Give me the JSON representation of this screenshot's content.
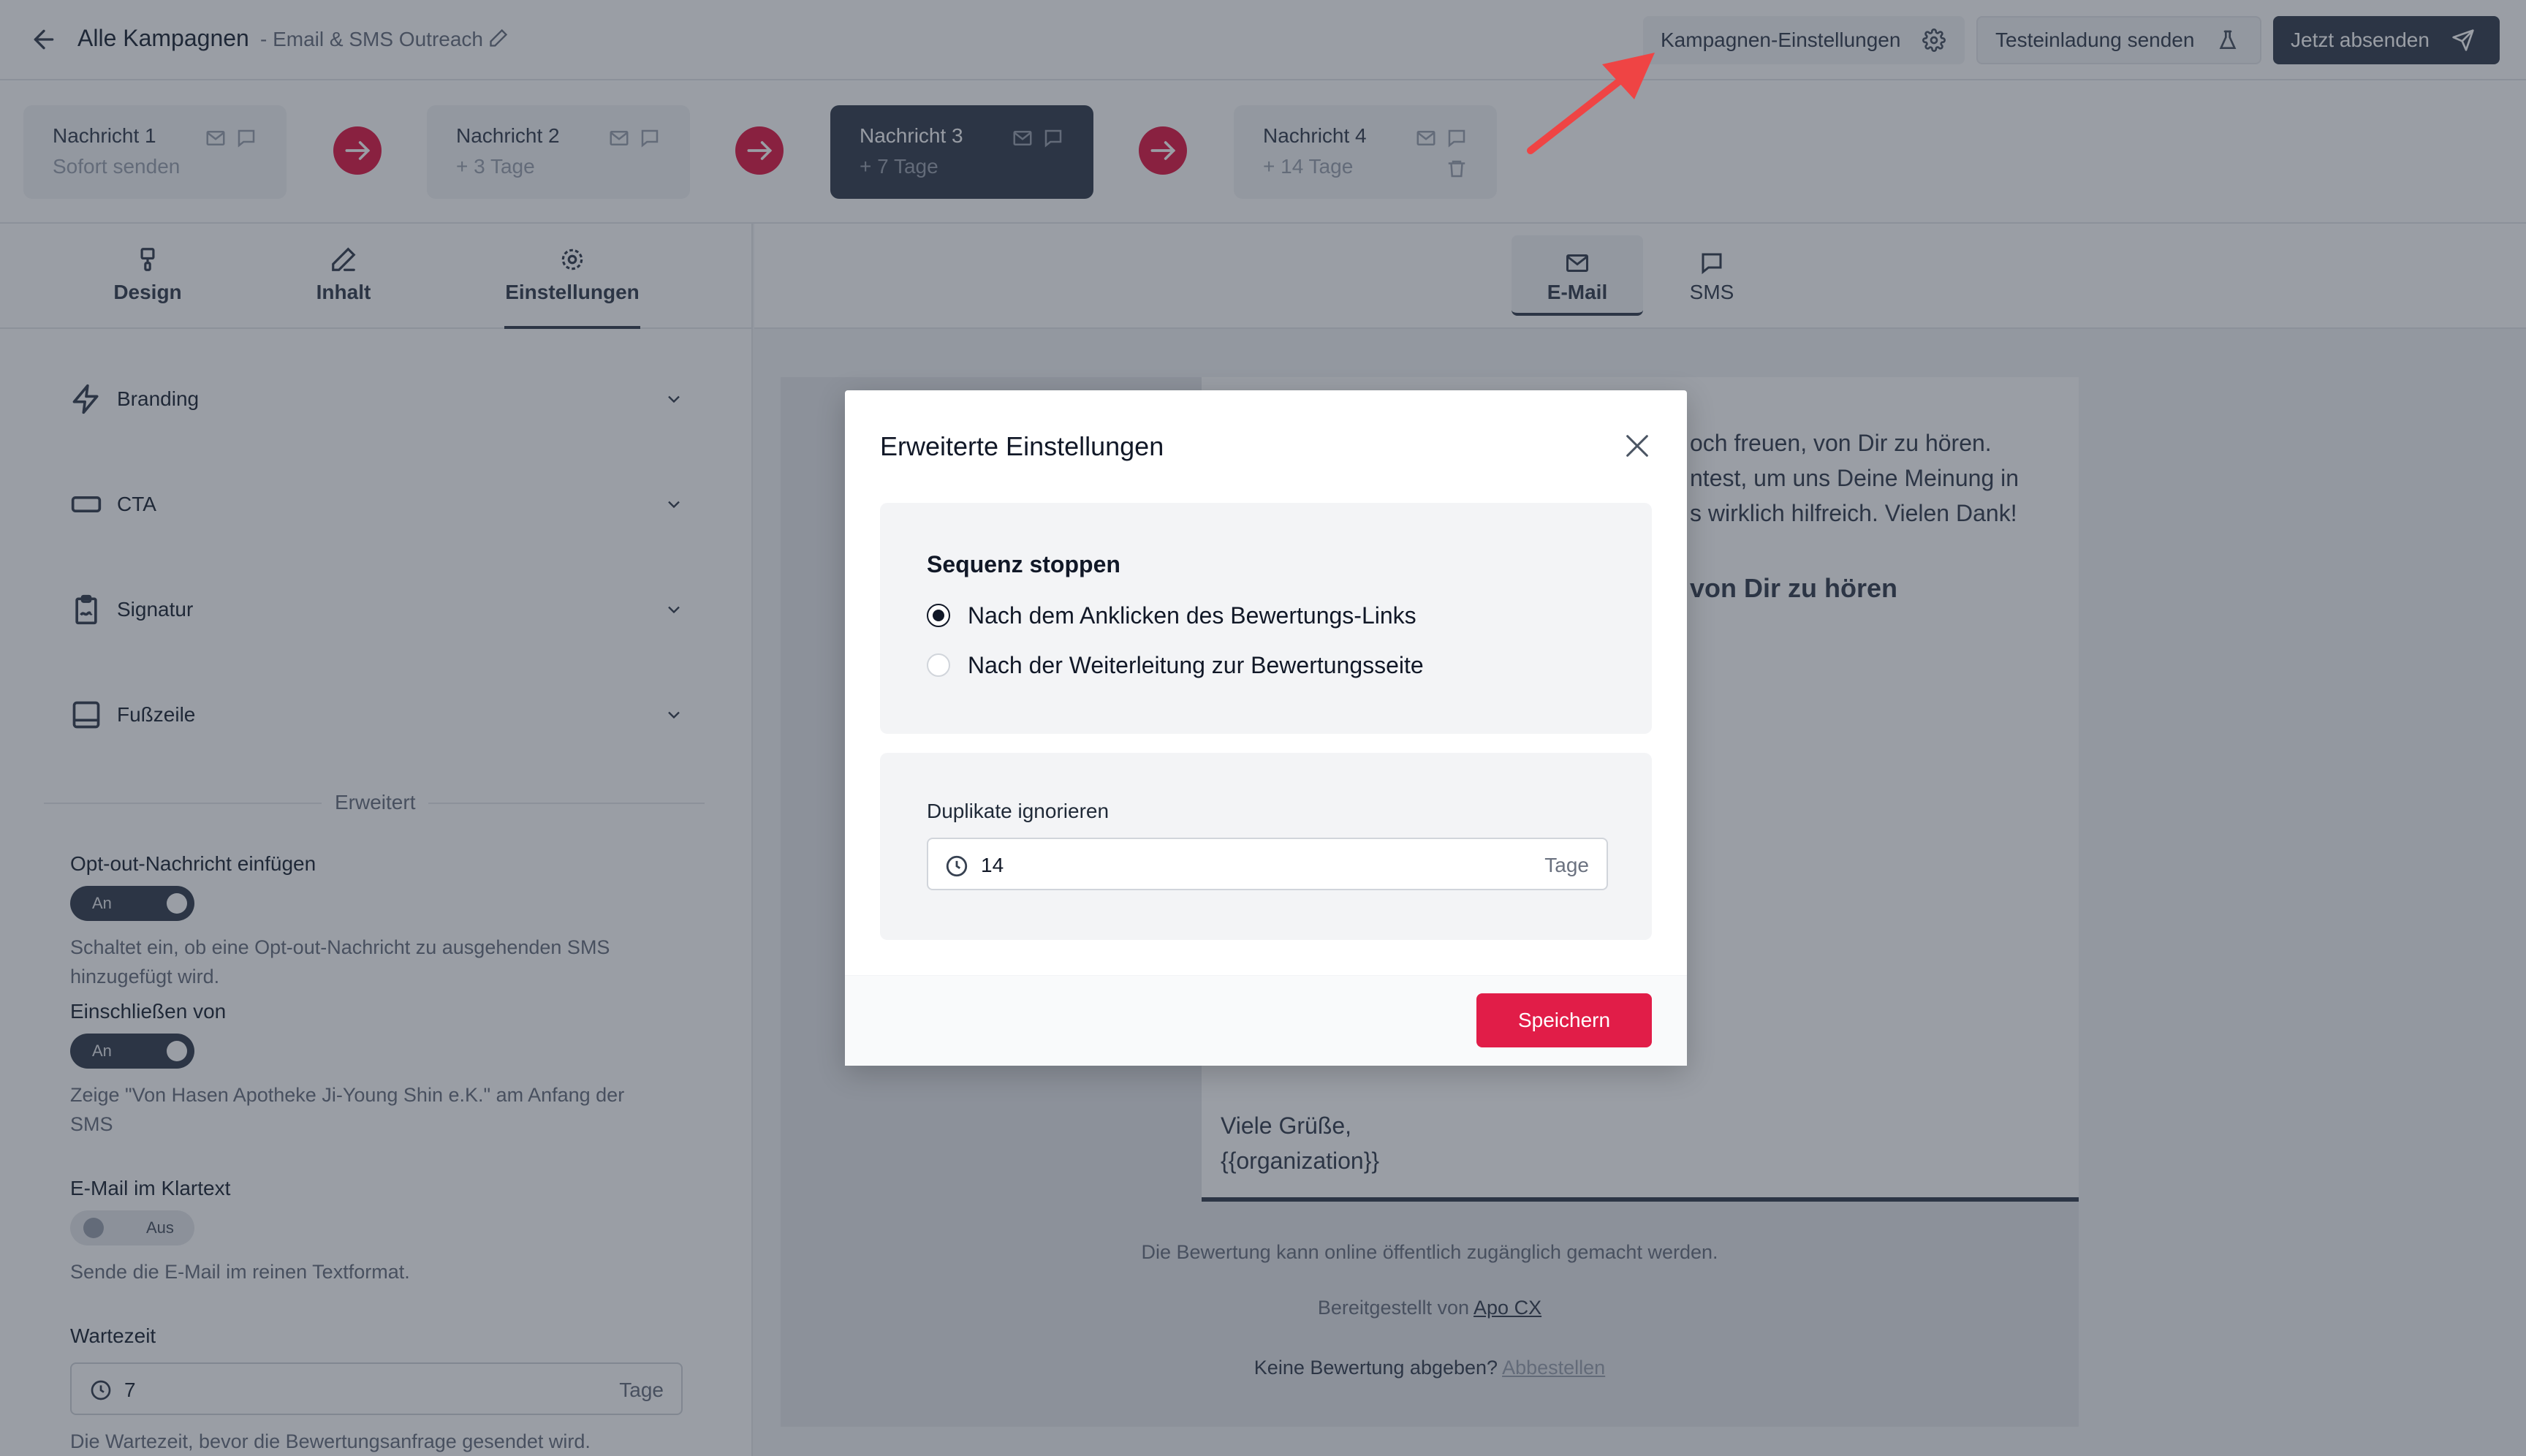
{
  "header": {
    "title": "Alle Kampagnen",
    "subtitle": "- Email & SMS Outreach",
    "settings_label": "Kampagnen-Einstellungen",
    "test_label": "Testeinladung senden",
    "send_label": "Jetzt absenden"
  },
  "steps": [
    {
      "title": "Nachricht 1",
      "sub": "Sofort senden"
    },
    {
      "title": "Nachricht 2",
      "sub": "+ 3 Tage"
    },
    {
      "title": "Nachricht 3",
      "sub": "+ 7 Tage"
    },
    {
      "title": "Nachricht 4",
      "sub": "+ 14 Tage"
    }
  ],
  "left_tabs": [
    "Design",
    "Inhalt",
    "Einstellungen"
  ],
  "accordions": [
    "Branding",
    "CTA",
    "Signatur",
    "Fußzeile"
  ],
  "advanced": {
    "divider": "Erweitert",
    "optout_label": "Opt-out-Nachricht einfügen",
    "optout_toggle": "An",
    "optout_help": "Schaltet ein, ob eine Opt-out-Nachricht zu ausgehenden SMS hinzugefügt wird.",
    "include_label": "Einschließen von",
    "include_toggle": "An",
    "include_help": "Zeige \"Von Hasen Apotheke Ji-Young Shin e.K.\" am Anfang der SMS",
    "plaintext_label": "E-Mail im Klartext",
    "plaintext_toggle": "Aus",
    "plaintext_help": "Sende die E-Mail im reinen Textformat.",
    "wait_label": "Wartezeit",
    "wait_value": "7",
    "wait_unit": "Tage",
    "wait_help": "Die Wartezeit, bevor die Bewertungsanfrage gesendet wird."
  },
  "channels": [
    "E-Mail",
    "SMS"
  ],
  "preview": {
    "line1": "och freuen, von Dir zu hören.",
    "line2": "ntest, um uns Deine Meinung in",
    "line3": "s wirklich hilfreich. Vielen Dank!",
    "heading": "von Dir zu hören",
    "greeting": "Viele Grüße,",
    "org": "{{organization}}",
    "footer1": "Die Bewertung kann online öffentlich zugänglich gemacht werden.",
    "footer2_prefix": "Bereitgestellt von",
    "footer2_link": "Apo CX",
    "footer3_prefix": "Keine Bewertung abgeben?",
    "footer3_link": "Abbestellen"
  },
  "modal": {
    "title": "Erweiterte Einstellungen",
    "seq_heading": "Sequenz stoppen",
    "option1": "Nach dem Anklicken des Bewertungs-Links",
    "option2": "Nach der Weiterleitung zur Bewertungsseite",
    "dup_label": "Duplikate ignorieren",
    "dup_value": "14",
    "dup_unit": "Tage",
    "save_label": "Speichern"
  },
  "colors": {
    "accent": "#e11d48",
    "dark": "#374151",
    "annotation": "#ef4444"
  }
}
